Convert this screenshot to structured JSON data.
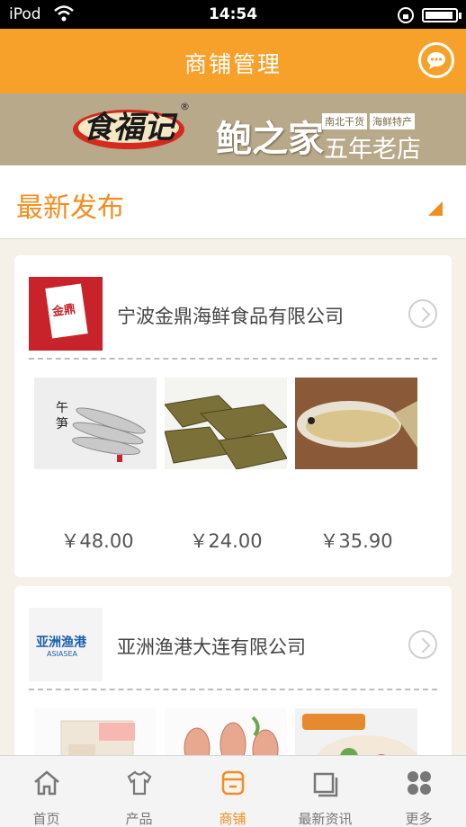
{
  "status_bar": {
    "carrier": "iPod",
    "time": "14:54"
  },
  "header": {
    "title": "商铺管理"
  },
  "banner": {
    "logo_text": "食福记",
    "reg_mark": "®",
    "brand": "鲍之家",
    "tags": [
      "南北干货",
      "海鲜特产"
    ],
    "slogan": "五年老店"
  },
  "section": {
    "title": "最新发布"
  },
  "shops": [
    {
      "name": "宁波金鼎海鲜食品有限公司",
      "logo_text": "金鼎",
      "products": [
        {
          "price": "￥48.00"
        },
        {
          "price": "￥24.00"
        },
        {
          "price": "￥35.90"
        }
      ]
    },
    {
      "name": "亚洲渔港大连有限公司",
      "logo_text": "亚洲渔港",
      "logo_sub": "ASIASEA",
      "products": [
        {
          "price": ""
        },
        {
          "price": ""
        },
        {
          "price": ""
        }
      ]
    }
  ],
  "tabbar": {
    "items": [
      {
        "label": "首页",
        "icon": "home-icon"
      },
      {
        "label": "产品",
        "icon": "shirt-icon"
      },
      {
        "label": "商铺",
        "icon": "store-icon",
        "active": true
      },
      {
        "label": "最新资讯",
        "icon": "news-icon"
      },
      {
        "label": "更多",
        "icon": "grid-icon"
      }
    ]
  },
  "colors": {
    "accent": "#f7a12b",
    "accent_text": "#f28e1e"
  }
}
